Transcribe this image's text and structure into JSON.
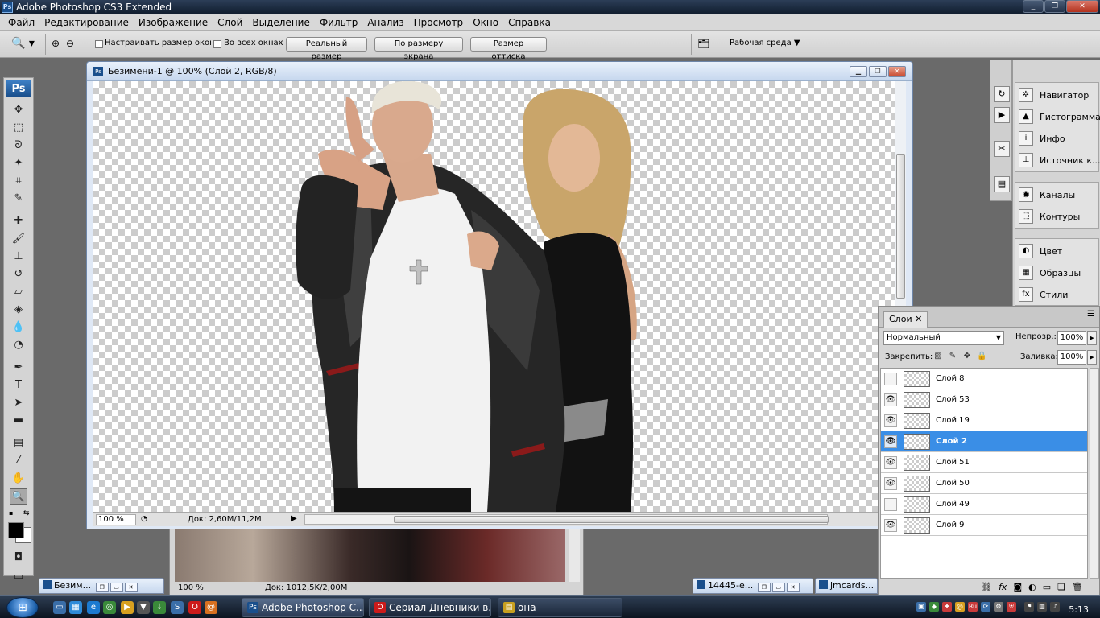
{
  "window": {
    "title": "Adobe Photoshop CS3 Extended",
    "app_icon": "Ps",
    "controls": [
      "_",
      "❐",
      "✕"
    ]
  },
  "menu": [
    "Файл",
    "Редактирование",
    "Изображение",
    "Слой",
    "Выделение",
    "Фильтр",
    "Анализ",
    "Просмотр",
    "Окно",
    "Справка"
  ],
  "options": {
    "fit_windows": "Настраивать размер окон",
    "all_windows": "Во всех окнах",
    "actual_pixels": "Реальный размер",
    "fit_screen": "По размеру экрана",
    "print_size": "Размер оттиска",
    "workspace": "Рабочая среда ▼"
  },
  "toolbox": {
    "logo": "Ps"
  },
  "document": {
    "title": "Безимени-1 @ 100% (Слой 2, RGB/8)",
    "zoom": "100 %",
    "doc_size": "Док: 2,60M/11,2M"
  },
  "bg_document": {
    "zoom": "100 %",
    "doc_size": "Док: 1012,5K/2,00M"
  },
  "dock": {
    "navigator": "Навигатор",
    "histogram": "Гистограмма",
    "info": "Инфо",
    "clone_source": "Источник к...",
    "channels": "Каналы",
    "paths": "Контуры",
    "color": "Цвет",
    "swatches": "Образцы",
    "styles": "Стили"
  },
  "layers_panel": {
    "tab": "Слои ✕",
    "blend_mode": "Нормальный",
    "opacity_label": "Непрозр.:",
    "opacity": "100%",
    "lock_label": "Закрепить:",
    "fill_label": "Заливка:",
    "fill": "100%",
    "layers": [
      {
        "name": "Слой 8",
        "visible": false,
        "selected": false
      },
      {
        "name": "Слой 53",
        "visible": true,
        "selected": false
      },
      {
        "name": "Слой 19",
        "visible": true,
        "selected": false
      },
      {
        "name": "Слой 2",
        "visible": true,
        "selected": true
      },
      {
        "name": "Слой 51",
        "visible": true,
        "selected": false
      },
      {
        "name": "Слой 50",
        "visible": true,
        "selected": false
      },
      {
        "name": "Слой 49",
        "visible": false,
        "selected": false
      },
      {
        "name": "Слой 9",
        "visible": true,
        "selected": false
      }
    ],
    "footer_icons": [
      "link-icon",
      "fx-icon",
      "mask-icon",
      "adjustment-icon",
      "group-icon",
      "new-layer-icon",
      "trash-icon"
    ]
  },
  "minimized": [
    {
      "title": "Безим..."
    },
    {
      "title": "14445-e..."
    },
    {
      "title": "jmcards..."
    }
  ],
  "taskbar": {
    "tasks": [
      {
        "label": "Adobe Photoshop C...",
        "icon": "Ps",
        "color": "#1a4f8c"
      },
      {
        "label": "Сериал Дневники в...",
        "icon": "O",
        "color": "#cc1b1b"
      },
      {
        "label": "она",
        "icon": "▤",
        "color": "#c8a020"
      }
    ],
    "time": "5:13"
  }
}
